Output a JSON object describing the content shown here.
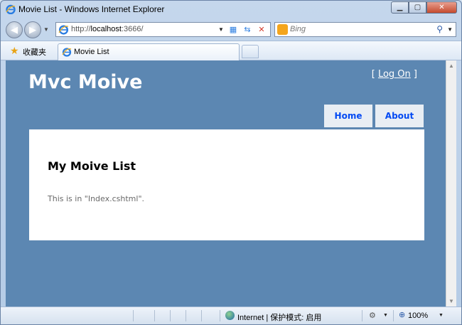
{
  "window": {
    "title": "Movie List - Windows Internet Explorer"
  },
  "address_bar": {
    "url_prefix": "http://",
    "url_host": "localhost",
    "url_rest": ":3666/"
  },
  "search": {
    "placeholder": "Bing"
  },
  "favorites": {
    "label": "收藏夹"
  },
  "tab": {
    "title": "Movie List"
  },
  "site": {
    "title": "Mvc Moive",
    "login": {
      "open_bracket": "[",
      "link": "Log On",
      "close_bracket": "]"
    },
    "menu": [
      {
        "label": "Home"
      },
      {
        "label": "About"
      }
    ],
    "heading": "My Moive List",
    "body_text": "This is in \"Index.cshtml\"."
  },
  "statusbar": {
    "zone": "Internet | 保护模式: 启用",
    "zoom": "100%"
  },
  "colors": {
    "page_background": "#5c87b2",
    "menu_tab": "#e8eef4",
    "menu_text": "#034af3"
  },
  "icons": {
    "back": "back-arrow-icon",
    "forward": "forward-arrow-icon",
    "refresh": "refresh-icon",
    "stop": "stop-icon",
    "compat": "compatibility-view-icon",
    "search": "search-icon",
    "favorites": "favorites-star-icon",
    "globe": "internet-zone-icon",
    "zoom": "zoom-icon"
  }
}
